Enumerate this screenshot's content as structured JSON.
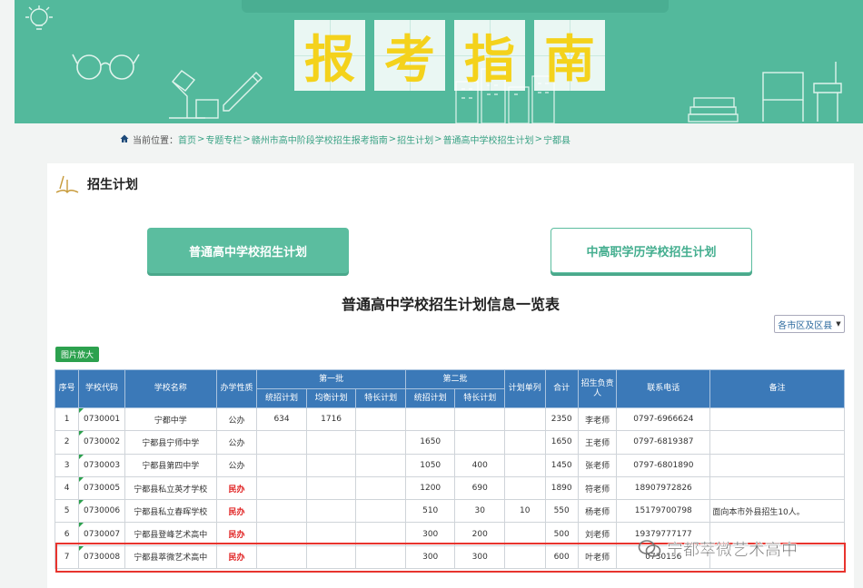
{
  "banner": {
    "title_chars": [
      "报",
      "考",
      "指",
      "南"
    ],
    "accent": "#53b99c",
    "title_color": "#f4d21c"
  },
  "breadcrumb": {
    "prefix": "当前位置：",
    "items": [
      "首页",
      "专题专栏",
      "赣州市高中阶段学校招生报考指南",
      "招生计划",
      "普通高中学校招生计划",
      "宁都县"
    ],
    "separator": ">"
  },
  "section": {
    "title": "招生计划"
  },
  "tabs": [
    {
      "label": "普通高中学校招生计划",
      "active": true
    },
    {
      "label": "中高职学历学校招生计划",
      "active": false
    }
  ],
  "table_title": "普通高中学校招生计划信息一览表",
  "region_select": {
    "value": "各市区及区县"
  },
  "zoom_button": {
    "label": "图片放大"
  },
  "table": {
    "headers": {
      "seq": "序号",
      "code": "学校代码",
      "name": "学校名称",
      "nature": "办学性质",
      "batch1": "第一批",
      "batch2": "第二批",
      "plan_list": "计划单列",
      "total": "合计",
      "contact_person": "招生负责人",
      "phone": "联系电话",
      "remarks": "备注",
      "sub_b1": [
        "统招计划",
        "均衡计划",
        "特长计划"
      ],
      "sub_b2": [
        "统招计划",
        "特长计划"
      ]
    },
    "rows": [
      {
        "seq": "1",
        "code": "0730001",
        "name": "宁都中学",
        "nature": "公办",
        "b1_tz": "634",
        "b1_jh": "1716",
        "b1_tc": "",
        "b2_tz": "",
        "b2_tc": "",
        "plan": "",
        "total": "2350",
        "person": "李老师",
        "phone": "0797-6966624",
        "note": ""
      },
      {
        "seq": "2",
        "code": "0730002",
        "name": "宁都县宁师中学",
        "nature": "公办",
        "b1_tz": "",
        "b1_jh": "",
        "b1_tc": "",
        "b2_tz": "1650",
        "b2_tc": "",
        "plan": "",
        "total": "1650",
        "person": "王老师",
        "phone": "0797-6819387",
        "note": ""
      },
      {
        "seq": "3",
        "code": "0730003",
        "name": "宁都县第四中学",
        "nature": "公办",
        "b1_tz": "",
        "b1_jh": "",
        "b1_tc": "",
        "b2_tz": "1050",
        "b2_tc": "400",
        "plan": "",
        "total": "1450",
        "person": "张老师",
        "phone": "0797-6801890",
        "note": ""
      },
      {
        "seq": "4",
        "code": "0730005",
        "name": "宁都县私立英才学校",
        "nature": "民办",
        "b1_tz": "",
        "b1_jh": "",
        "b1_tc": "",
        "b2_tz": "1200",
        "b2_tc": "690",
        "plan": "",
        "total": "1890",
        "person": "符老师",
        "phone": "18907972826",
        "note": ""
      },
      {
        "seq": "5",
        "code": "0730006",
        "name": "宁都县私立春晖学校",
        "nature": "民办",
        "b1_tz": "",
        "b1_jh": "",
        "b1_tc": "",
        "b2_tz": "510",
        "b2_tc": "30",
        "plan": "10",
        "total": "550",
        "person": "杨老师",
        "phone": "15179700798",
        "note": "面向本市外县招生10人。"
      },
      {
        "seq": "6",
        "code": "0730007",
        "name": "宁都县登峰艺术高中",
        "nature": "民办",
        "b1_tz": "",
        "b1_jh": "",
        "b1_tc": "",
        "b2_tz": "300",
        "b2_tc": "200",
        "plan": "",
        "total": "500",
        "person": "刘老师",
        "phone": "19379777177",
        "note": ""
      },
      {
        "seq": "7",
        "code": "0730008",
        "name": "宁都县萃微艺术高中",
        "nature": "民办",
        "b1_tz": "",
        "b1_jh": "",
        "b1_tc": "",
        "b2_tz": "300",
        "b2_tc": "300",
        "plan": "",
        "total": "600",
        "person": "叶老师",
        "phone": "0730156",
        "note": ""
      }
    ]
  },
  "watermark": {
    "text": "宁都萃微艺术高中"
  },
  "colors": {
    "header_blue": "#3b79b8",
    "private_red": "#e02020",
    "highlight": "#e8342e",
    "zoom_green": "#2ca14e"
  }
}
